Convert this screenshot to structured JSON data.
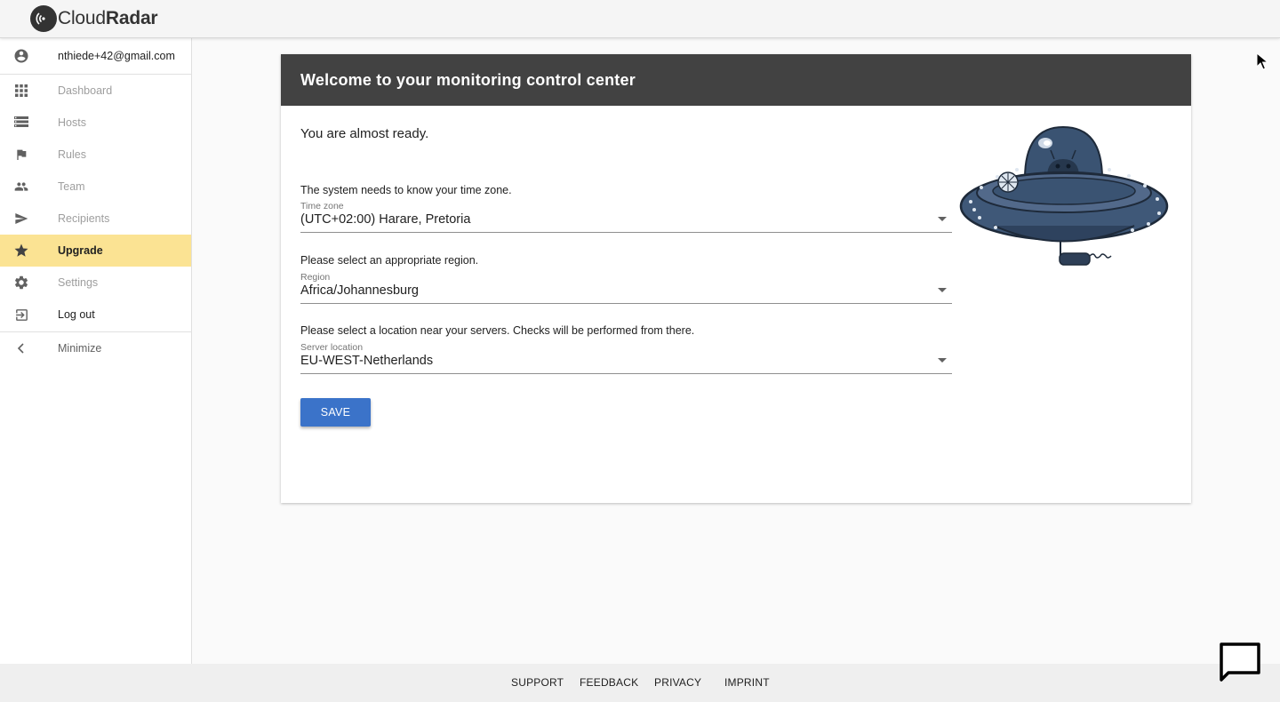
{
  "brand": {
    "name_part1": "Cloud",
    "name_part2": "Radar"
  },
  "user": {
    "email": "nthiede+42@gmail.com"
  },
  "sidebar": {
    "items": [
      {
        "label": "Dashboard",
        "icon": "grid-icon"
      },
      {
        "label": "Hosts",
        "icon": "server-list-icon"
      },
      {
        "label": "Rules",
        "icon": "flag-icon"
      },
      {
        "label": "Team",
        "icon": "people-icon"
      },
      {
        "label": "Recipients",
        "icon": "send-icon"
      },
      {
        "label": "Upgrade",
        "icon": "star-icon"
      },
      {
        "label": "Settings",
        "icon": "gear-icon"
      },
      {
        "label": "Log out",
        "icon": "logout-icon"
      }
    ],
    "minimize_label": "Minimize",
    "active_color": "#fbe393"
  },
  "card": {
    "title": "Welcome to your monitoring control center",
    "subtitle": "You are almost ready.",
    "timezone": {
      "help": "The system needs to know your time zone.",
      "label": "Time zone",
      "value": "(UTC+02:00) Harare, Pretoria"
    },
    "region": {
      "help": "Please select an appropriate region.",
      "label": "Region",
      "value": "Africa/Johannesburg"
    },
    "location": {
      "help": "Please select a location near your servers. Checks will be performed from there.",
      "label": "Server location",
      "value": "EU-WEST-Netherlands"
    },
    "save_label": "SAVE"
  },
  "footer": {
    "links": [
      "SUPPORT",
      "FEEDBACK",
      "PRIVACY",
      "IMPRINT"
    ]
  },
  "colors": {
    "header": "#424242",
    "primary": "#3b73c9"
  }
}
